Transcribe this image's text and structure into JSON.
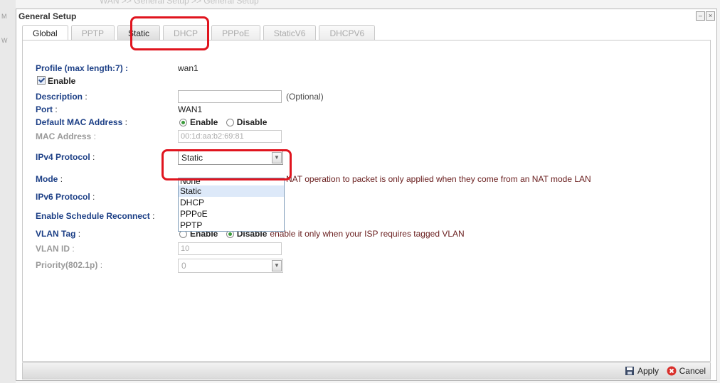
{
  "breadcrumb": "WAN >> General Setup >> General Setup",
  "window": {
    "title": "General Setup",
    "minimize_icon": "–",
    "close_icon": "×"
  },
  "tabs": [
    "Global",
    "PPTP",
    "Static",
    "DHCP",
    "PPPoE",
    "StaticV6",
    "DHCPV6"
  ],
  "form": {
    "profile": {
      "label": "Profile (max length:7) :",
      "value": "wan1"
    },
    "enable_checkbox": {
      "label": "Enable",
      "checked": true
    },
    "description": {
      "label": "Description",
      "value": "",
      "hint": "(Optional)"
    },
    "port": {
      "label": "Port",
      "value": "WAN1"
    },
    "default_mac": {
      "label": "Default MAC Address",
      "options": [
        "Enable",
        "Disable"
      ],
      "selected": "Enable"
    },
    "mac_address": {
      "label": "MAC Address",
      "value": "00:1d:aa:b2:69:81"
    },
    "ipv4_protocol": {
      "label": "IPv4 Protocol",
      "value": "Static",
      "options": [
        "None",
        "Static",
        "DHCP",
        "PPPoE",
        "PPTP"
      ],
      "highlighted": "Static"
    },
    "mode": {
      "label": "Mode",
      "note": "NAT operation to packet is only applied when they come from an NAT mode LAN"
    },
    "ipv6_protocol": {
      "label": "IPv6 Protocol"
    },
    "schedule": {
      "label": "Enable Schedule Reconnect"
    },
    "vlan_tag": {
      "label": "VLAN Tag",
      "options": [
        "Enable",
        "Disable"
      ],
      "selected": "Disable",
      "note": "enable it only when your ISP requires tagged VLAN"
    },
    "vlan_id": {
      "label": "VLAN ID",
      "value": "10"
    },
    "priority": {
      "label": "Priority(802.1p)",
      "value": "0"
    }
  },
  "footer": {
    "apply": "Apply",
    "cancel": "Cancel"
  },
  "colors": {
    "label": "#1c3f86",
    "highlight": "#e0141e",
    "note": "#6b2020"
  }
}
